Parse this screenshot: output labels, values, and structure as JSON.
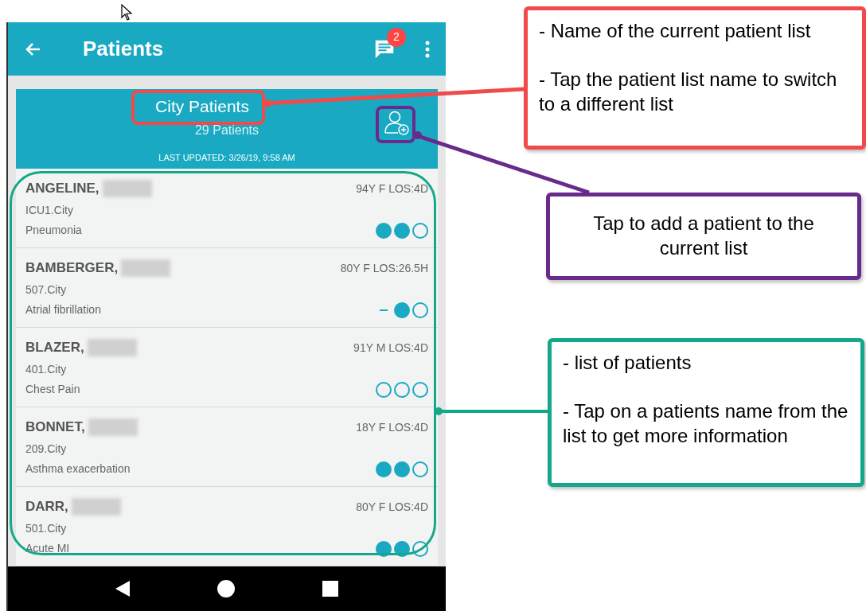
{
  "app_bar": {
    "title": "Patients",
    "badge": "2"
  },
  "list_header": {
    "name": "City Patients",
    "count": "29 Patients",
    "updated": "LAST UPDATED: 3/26/19, 9:58 AM"
  },
  "patients": [
    {
      "name": "ANGELINE,",
      "info": "94Y F LOS:4D",
      "location": "ICU1.City",
      "diagnosis": "Pneumonia",
      "indicators": [
        {
          "kind": "filled"
        },
        {
          "kind": "filled"
        },
        {
          "kind": "empty"
        }
      ]
    },
    {
      "name": "BAMBERGER,",
      "info": "80Y F LOS:26.5H",
      "location": "507.City",
      "diagnosis": "Atrial fibrillation",
      "indicators": [
        {
          "kind": "dash"
        },
        {
          "kind": "filled"
        },
        {
          "kind": "empty"
        }
      ]
    },
    {
      "name": "BLAZER,",
      "info": "91Y M LOS:4D",
      "location": "401.City",
      "diagnosis": "Chest Pain",
      "indicators": [
        {
          "kind": "empty"
        },
        {
          "kind": "empty"
        },
        {
          "kind": "empty"
        }
      ]
    },
    {
      "name": "BONNET,",
      "info": "18Y F LOS:4D",
      "location": "209.City",
      "diagnosis": "Asthma exacerbation",
      "indicators": [
        {
          "kind": "filled"
        },
        {
          "kind": "filled"
        },
        {
          "kind": "empty"
        }
      ]
    },
    {
      "name": "DARR,",
      "info": "80Y F LOS:4D",
      "location": "501.City",
      "diagnosis": "Acute MI",
      "indicators": [
        {
          "kind": "filled"
        },
        {
          "kind": "filled"
        },
        {
          "kind": "empty"
        }
      ]
    }
  ],
  "callouts": [
    {
      "color": "#f04a4a",
      "centered": false,
      "paragraphs": [
        "- Name of the current patient list",
        "- Tap the patient list name to switch to a different list"
      ]
    },
    {
      "color": "#6a2a8c",
      "centered": true,
      "paragraphs": [
        "Tap to add a patient to the current list"
      ]
    },
    {
      "color": "#14a88a",
      "centered": false,
      "paragraphs": [
        "- list of patients",
        "- Tap on a patients name from the list to get more information"
      ]
    }
  ]
}
